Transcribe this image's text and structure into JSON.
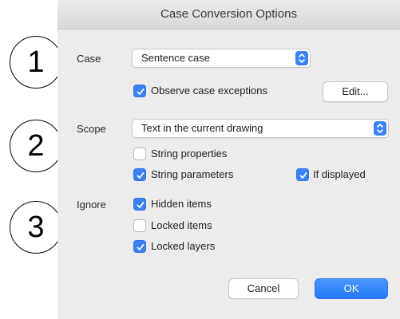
{
  "dialog": {
    "title": "Case Conversion Options"
  },
  "callouts": [
    "1",
    "2",
    "3"
  ],
  "case_section": {
    "label": "Case",
    "popup_value": "Sentence case",
    "observe_exceptions": {
      "label": "Observe case exceptions",
      "checked": true
    },
    "edit_button": "Edit..."
  },
  "scope_section": {
    "label": "Scope",
    "popup_value": "Text in the current drawing",
    "string_properties": {
      "label": "String properties",
      "checked": false
    },
    "string_parameters": {
      "label": "String parameters",
      "checked": true
    },
    "if_displayed": {
      "label": "If displayed",
      "checked": true
    }
  },
  "ignore_section": {
    "label": "Ignore",
    "hidden_items": {
      "label": "Hidden items",
      "checked": true
    },
    "locked_items": {
      "label": "Locked items",
      "checked": false
    },
    "locked_layers": {
      "label": "Locked layers",
      "checked": true
    }
  },
  "buttons": {
    "cancel": "Cancel",
    "ok": "OK"
  },
  "colors": {
    "accent": "#3b82f6",
    "dialog_bg": "#ececec"
  }
}
